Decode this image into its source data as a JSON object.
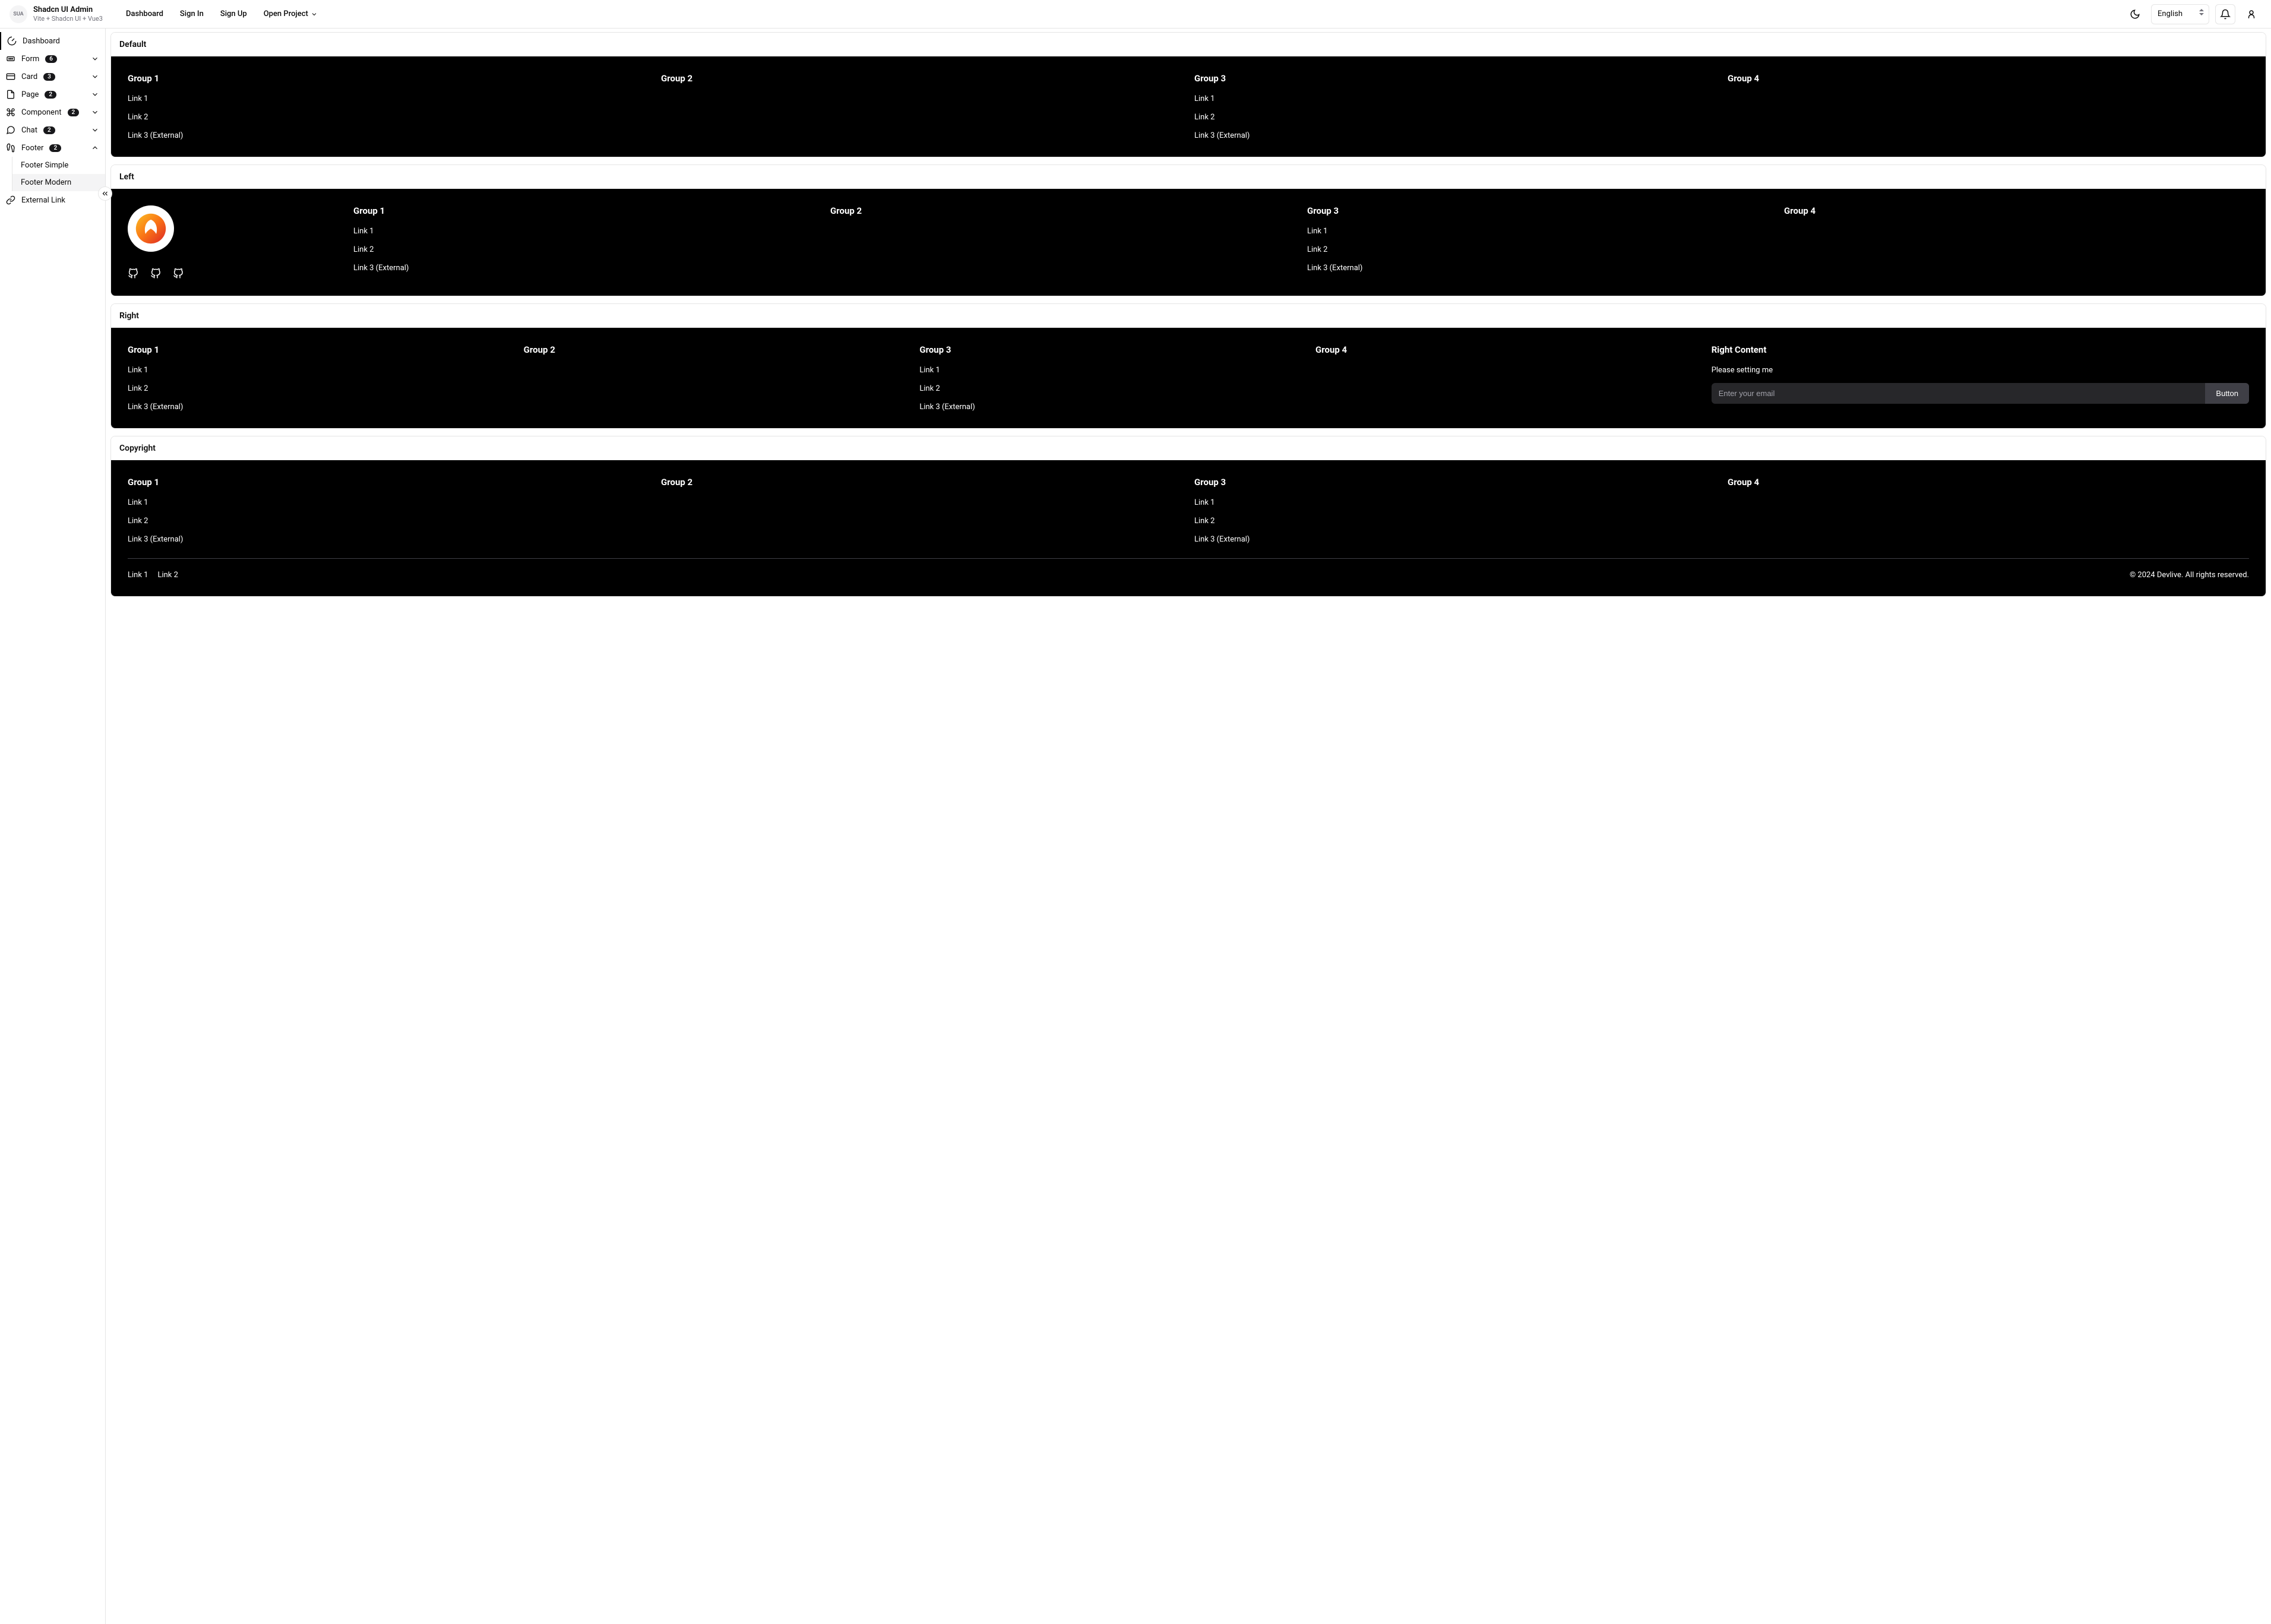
{
  "brand": {
    "abbr": "SUA",
    "title": "Shadcn UI Admin",
    "subtitle": "Vite + Shadcn UI + Vue3"
  },
  "topnav": {
    "dashboard": "Dashboard",
    "signin": "Sign In",
    "signup": "Sign Up",
    "open_project": "Open Project"
  },
  "header": {
    "language": "English"
  },
  "sidebar": {
    "dashboard": "Dashboard",
    "form": {
      "label": "Form",
      "count": "6"
    },
    "card": {
      "label": "Card",
      "count": "3"
    },
    "page": {
      "label": "Page",
      "count": "2"
    },
    "component": {
      "label": "Component",
      "count": "2"
    },
    "chat": {
      "label": "Chat",
      "count": "2"
    },
    "footer": {
      "label": "Footer",
      "count": "2",
      "simple": "Footer Simple",
      "modern": "Footer Modern"
    },
    "external": "External Link"
  },
  "sections": {
    "default": {
      "title": "Default",
      "groups": [
        {
          "title": "Group 1",
          "links": [
            "Link 1",
            "Link 2",
            "Link 3 (External)"
          ]
        },
        {
          "title": "Group 2",
          "links": []
        },
        {
          "title": "Group 3",
          "links": [
            "Link 1",
            "Link 2",
            "Link 3 (External)"
          ]
        },
        {
          "title": "Group 4",
          "links": []
        }
      ]
    },
    "left": {
      "title": "Left",
      "groups": [
        {
          "title": "Group 1",
          "links": [
            "Link 1",
            "Link 2",
            "Link 3 (External)"
          ]
        },
        {
          "title": "Group 2",
          "links": []
        },
        {
          "title": "Group 3",
          "links": [
            "Link 1",
            "Link 2",
            "Link 3 (External)"
          ]
        },
        {
          "title": "Group 4",
          "links": []
        }
      ]
    },
    "right": {
      "title": "Right",
      "groups": [
        {
          "title": "Group 1",
          "links": [
            "Link 1",
            "Link 2",
            "Link 3 (External)"
          ]
        },
        {
          "title": "Group 2",
          "links": []
        },
        {
          "title": "Group 3",
          "links": [
            "Link 1",
            "Link 2",
            "Link 3 (External)"
          ]
        },
        {
          "title": "Group 4",
          "links": []
        }
      ],
      "right_title": "Right Content",
      "right_desc": "Please setting me",
      "placeholder": "Enter your email",
      "button": "Button"
    },
    "copyright": {
      "title": "Copyright",
      "groups": [
        {
          "title": "Group 1",
          "links": [
            "Link 1",
            "Link 2",
            "Link 3 (External)"
          ]
        },
        {
          "title": "Group 2",
          "links": []
        },
        {
          "title": "Group 3",
          "links": [
            "Link 1",
            "Link 2",
            "Link 3 (External)"
          ]
        },
        {
          "title": "Group 4",
          "links": []
        }
      ],
      "bottom_links": [
        "Link 1",
        "Link 2"
      ],
      "copy": "© 2024 Devlive. All rights reserved."
    }
  }
}
